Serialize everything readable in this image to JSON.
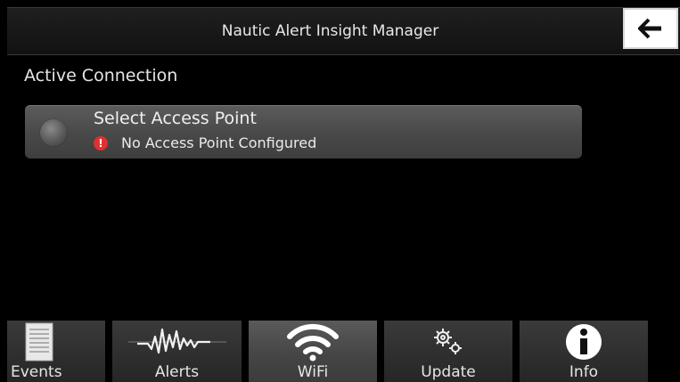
{
  "header": {
    "title": "Nautic Alert Insight Manager",
    "back_icon": "arrow-left-icon"
  },
  "main": {
    "section_label": "Active Connection",
    "access_point": {
      "title": "Select Access Point",
      "status": "No Access Point Configured",
      "status_icon": "alert-icon",
      "status_icon_glyph": "!"
    }
  },
  "tabs": [
    {
      "label": "Events",
      "icon": "document-icon",
      "active": false
    },
    {
      "label": "Alerts",
      "icon": "waveform-icon",
      "active": false
    },
    {
      "label": "WiFi",
      "icon": "wifi-icon",
      "active": true
    },
    {
      "label": "Update",
      "icon": "gears-icon",
      "active": false
    },
    {
      "label": "Info",
      "icon": "info-icon",
      "active": false
    }
  ],
  "colors": {
    "background": "#000000",
    "alert": "#e03030",
    "active_tab": "#4a4a4a"
  }
}
